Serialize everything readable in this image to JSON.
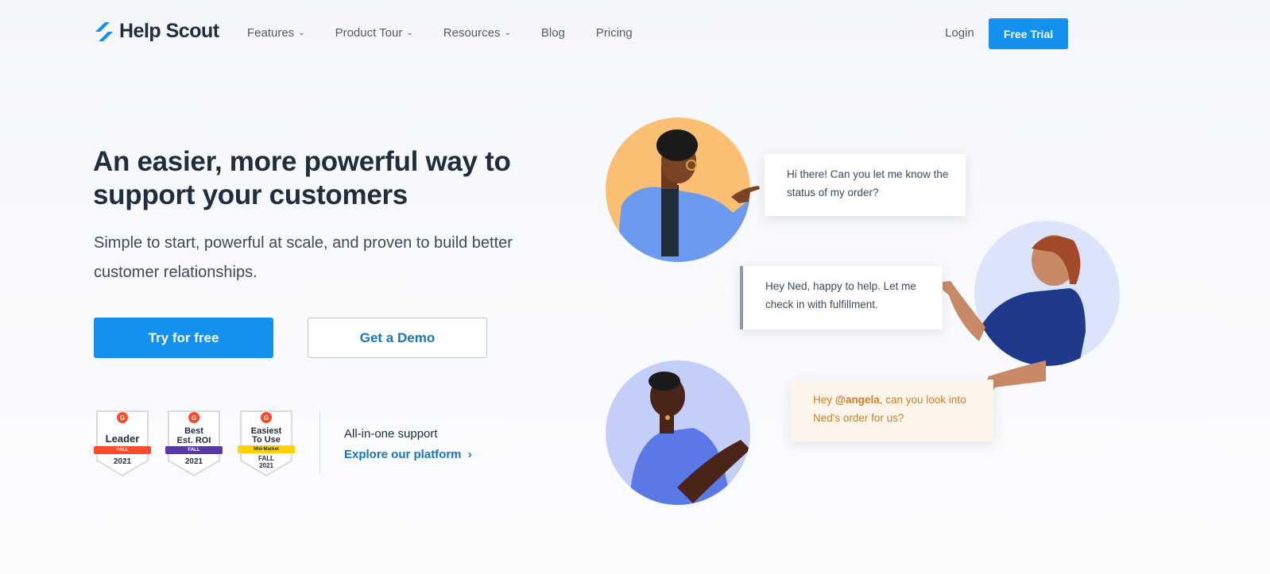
{
  "brand": {
    "name": "Help Scout"
  },
  "nav": {
    "items": [
      {
        "label": "Features",
        "has_dropdown": true
      },
      {
        "label": "Product Tour",
        "has_dropdown": true
      },
      {
        "label": "Resources",
        "has_dropdown": true
      },
      {
        "label": "Blog",
        "has_dropdown": false
      },
      {
        "label": "Pricing",
        "has_dropdown": false
      }
    ],
    "login": "Login",
    "cta": "Free Trial"
  },
  "hero": {
    "headline": "An easier, more powerful way to support your customers",
    "subheadline": "Simple to start, powerful at scale, and proven to build better customer relationships.",
    "primary_button": "Try for free",
    "secondary_button": "Get a Demo"
  },
  "badges": [
    {
      "title": "Leader",
      "ribbon": "FALL",
      "year": "2021",
      "ribbon_color": "#ff492c"
    },
    {
      "title_line1": "Best",
      "title_line2": "Est. ROI",
      "ribbon": "FALL",
      "year": "2021",
      "ribbon_color": "#5a39a2"
    },
    {
      "title_line1": "Easiest",
      "title_line2": "To Use",
      "ribbon": "Mid-Market",
      "season": "FALL",
      "year": "2021",
      "ribbon_color": "#ffd200"
    }
  ],
  "g2_label": "G",
  "platform": {
    "label": "All-in-one support",
    "link": "Explore our platform"
  },
  "chat": {
    "msg1": "Hi there! Can you let me know the status of my order?",
    "msg2": "Hey Ned, happy to help. Let me check in with fulfillment.",
    "msg3_prefix": "Hey ",
    "msg3_mention": "@angela",
    "msg3_suffix": ", can you look into Ned's order for us?"
  },
  "colors": {
    "primary": "#1292ee",
    "link": "#1a75bf",
    "text_dark": "#1f2d3d",
    "mention": "#c8812a"
  }
}
